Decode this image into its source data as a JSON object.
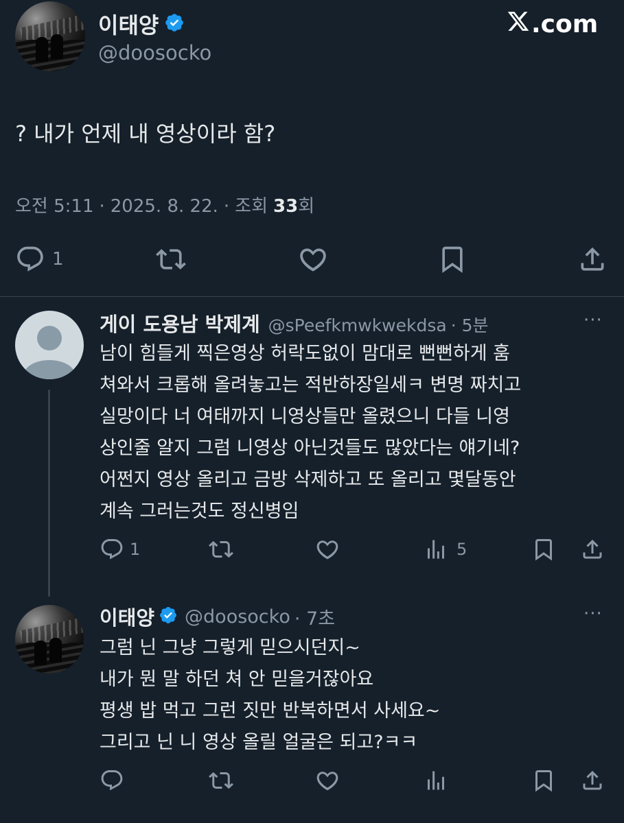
{
  "main_tweet": {
    "author_name": "이태양",
    "handle": "@doosocko",
    "text": "? 내가 언제 내 영상이라 함?",
    "time": "오전 5:11",
    "separator": "·",
    "date": "2025. 8. 22.",
    "views_label": "조회",
    "views_count": "33",
    "views_suffix": "회",
    "reply_count": "1"
  },
  "brand": {
    "logo_text": "X",
    "logo_suffix": ".com"
  },
  "replies": [
    {
      "author_name": "게이 도용남 박제계",
      "handle": "@sPeefkmwkwekdsa",
      "time": "· 5분",
      "more": "···",
      "lines": [
        "남이 힘들게 찍은영상 허락도없이 맘대로 뻔뻔하게 훔",
        "쳐와서 크롭해 올려놓고는 적반하장일세ㅋ 변명 짜치고",
        "실망이다 너 여태까지 니영상들만 올렸으니 다들 니영",
        "상인줄 알지 그럼 니영상 아닌것들도 많았다는 얘기네?",
        "어쩐지 영상 올리고 금방 삭제하고 또 올리고 몇달동안",
        "계속 그러는것도 정신병임"
      ],
      "reply_count": "1",
      "views_count": "5"
    },
    {
      "author_name": "이태양",
      "handle": "@doosocko",
      "time": "· 7초",
      "more": "···",
      "lines": [
        "그럼 닌 그냥 그렇게 믿으시던지~",
        "내가 뭔 말 하던 쳐 안 믿을거잖아요",
        "평생 밥 먹고 그런 짓만 반복하면서 사세요~",
        "그리고 닌 니 영상 올릴 얼굴은 되고?ㅋㅋ"
      ]
    }
  ],
  "colors": {
    "background": "#15202b",
    "text": "#e7e9ea",
    "secondary": "#8b98a5",
    "verified": "#1d9bf0",
    "divider": "#38444d"
  }
}
